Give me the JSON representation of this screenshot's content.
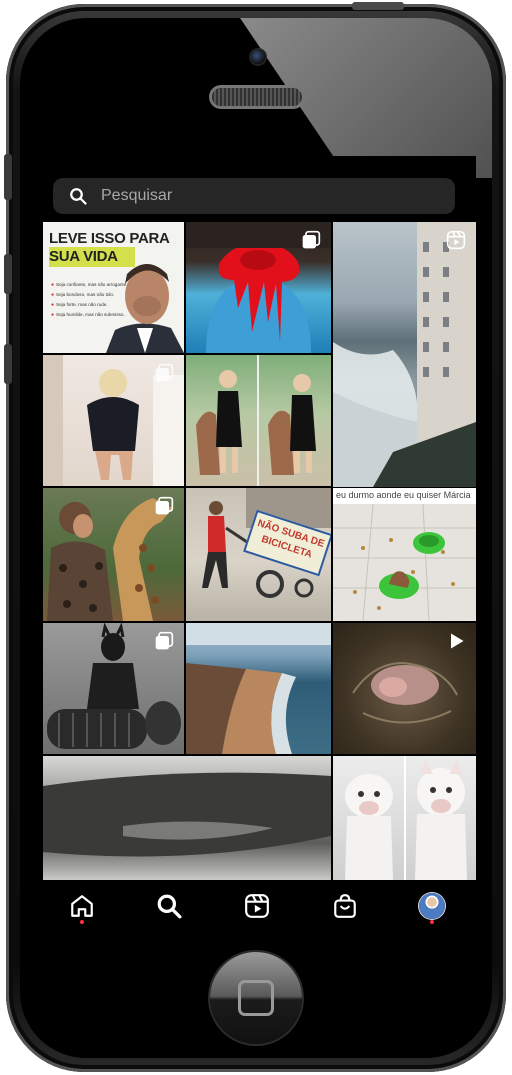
{
  "search": {
    "placeholder": "Pesquisar"
  },
  "posts": [
    {
      "id": "poster",
      "type": "image",
      "headline_line1": "LEVE ISSO PARA",
      "headline_line2": "SUA VIDA",
      "body_lines": [
        "Seja confiante, mas não arrogante.",
        "Seja bondoso, mas não tolo.",
        "Seja forte, mas não rude.",
        "Seja humilde, mas não submisso."
      ]
    },
    {
      "id": "red-slime",
      "type": "carousel"
    },
    {
      "id": "sea-waves",
      "type": "reel"
    },
    {
      "id": "woman-sweater",
      "type": "carousel"
    },
    {
      "id": "kids-dogs",
      "type": "image"
    },
    {
      "id": "woman-giraffe",
      "type": "carousel"
    },
    {
      "id": "cart-man",
      "type": "image",
      "sign_text": "NÃO SUBA DE BICICLETA"
    },
    {
      "id": "dog-bowls",
      "type": "image",
      "caption": "eu durmo aonde eu quiser Márcia"
    },
    {
      "id": "catwoman",
      "type": "carousel"
    },
    {
      "id": "coast-aerial",
      "type": "image"
    },
    {
      "id": "hippo-water",
      "type": "video"
    },
    {
      "id": "blurry-video",
      "type": "video"
    },
    {
      "id": "white-dogs",
      "type": "image"
    }
  ],
  "nav": {
    "items": [
      {
        "name": "home",
        "icon": "home-icon",
        "notification": true
      },
      {
        "name": "search",
        "icon": "search-icon",
        "notification": false
      },
      {
        "name": "reels",
        "icon": "reels-icon",
        "notification": false
      },
      {
        "name": "shop",
        "icon": "shop-icon",
        "notification": false
      },
      {
        "name": "profile",
        "icon": "avatar",
        "notification": true
      }
    ]
  },
  "colors": {
    "background": "#000000",
    "search_bg": "#262626",
    "placeholder": "#a8a8a8",
    "notification": "#ff3040",
    "accent_yellow": "#d4e04b"
  }
}
